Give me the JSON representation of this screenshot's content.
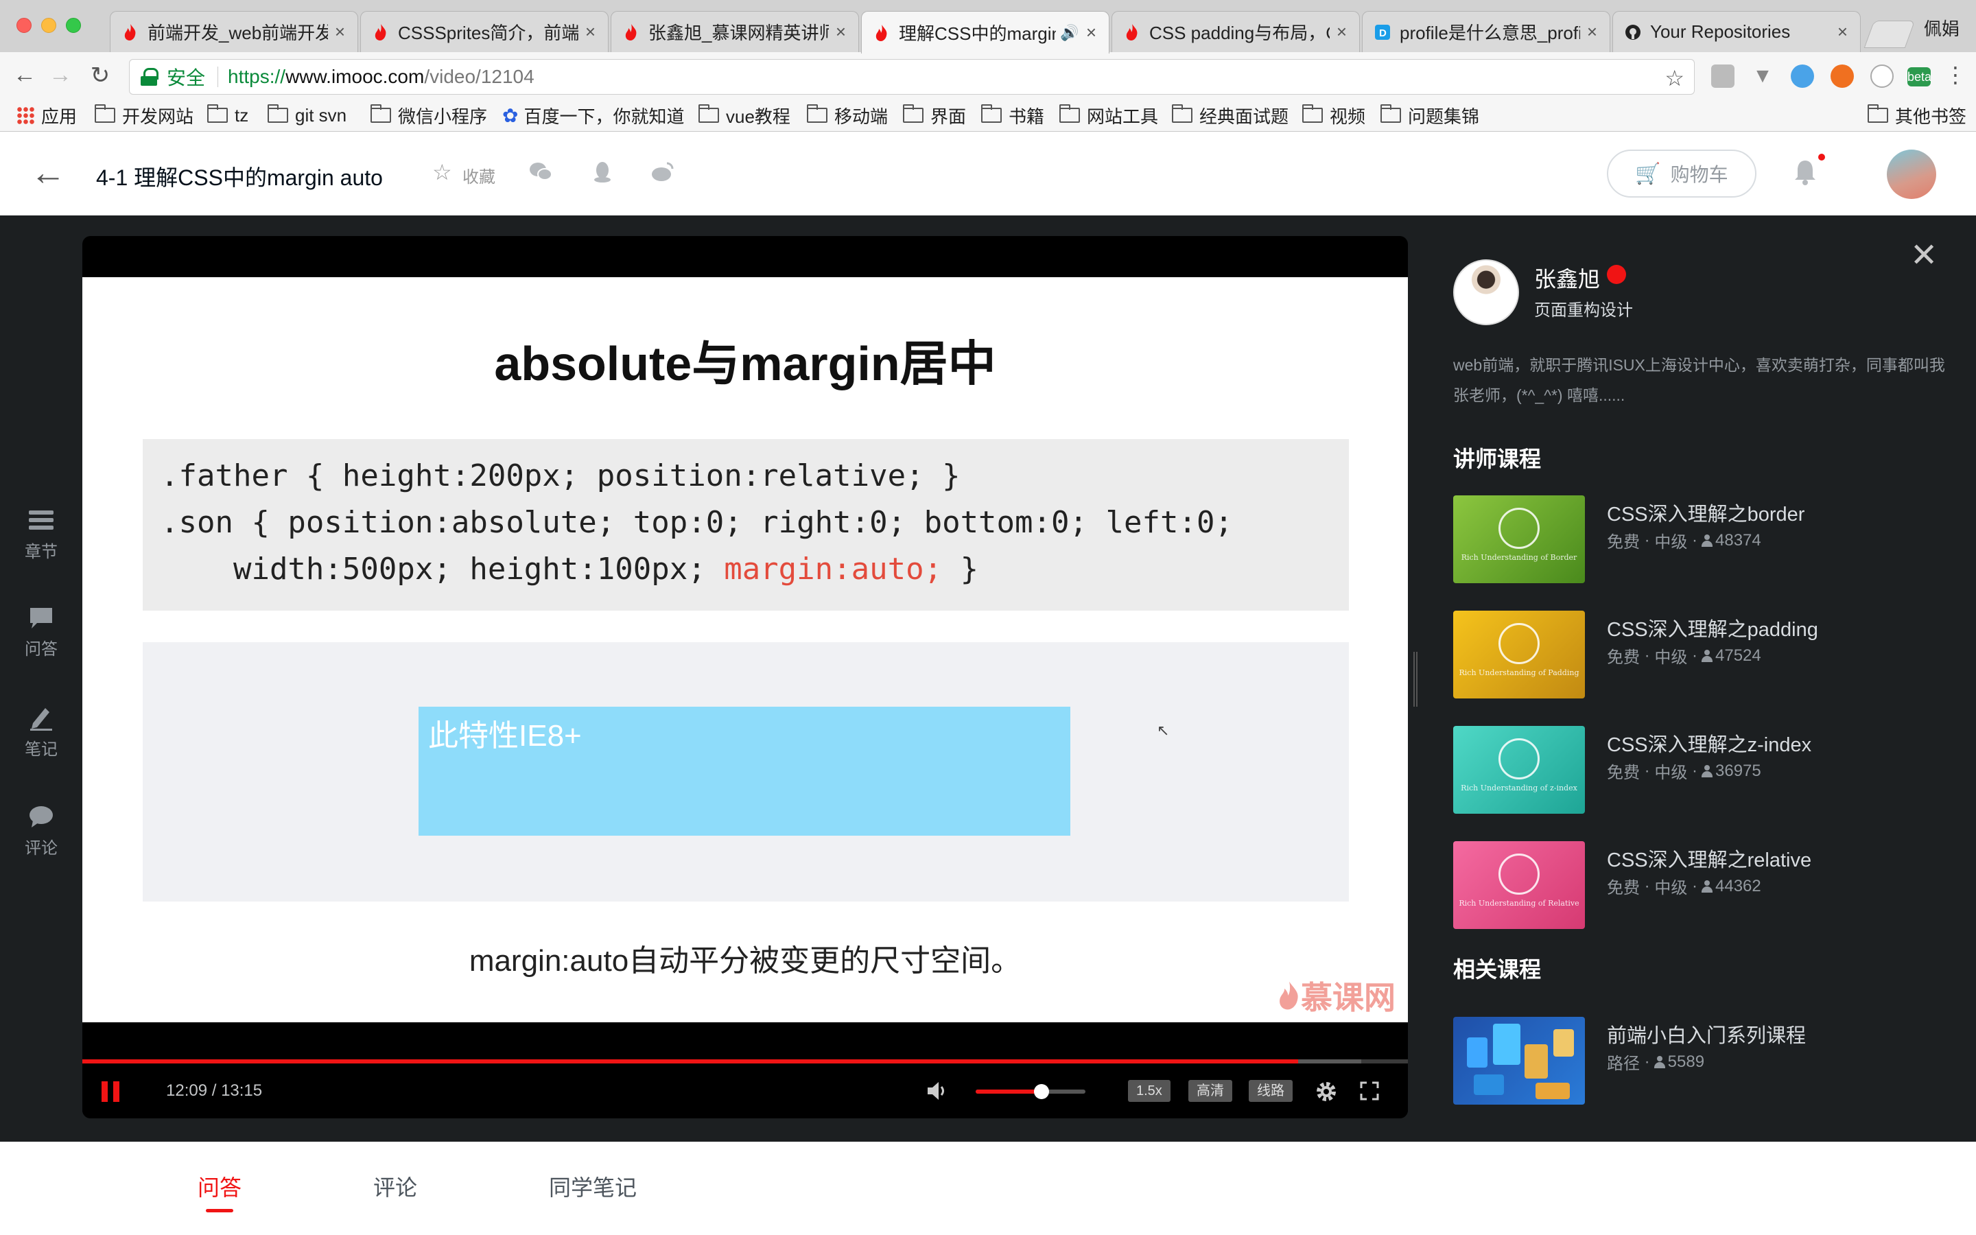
{
  "browser": {
    "tabs": [
      {
        "title": "前端开发_web前端开发",
        "favicon": "flame-icon",
        "active": false
      },
      {
        "title": "CSSSprites简介，前端",
        "favicon": "flame-icon",
        "active": false
      },
      {
        "title": "张鑫旭_慕课网精英讲师",
        "favicon": "flame-icon",
        "active": false
      },
      {
        "title": "理解CSS中的margin",
        "favicon": "flame-icon",
        "active": true
      },
      {
        "title": "CSS padding与布局，C",
        "favicon": "flame-icon",
        "active": false
      },
      {
        "title": "profile是什么意思_profi",
        "favicon": "d-icon",
        "active": false
      },
      {
        "title": "Your Repositories",
        "favicon": "github-icon",
        "active": false
      }
    ],
    "profile_name": "佩娟",
    "address": {
      "secure_label": "安全",
      "scheme": "https://",
      "host": "www.imooc.com",
      "path": "/video/12104"
    },
    "bookmarks": [
      "应用",
      "开发网站",
      "tz",
      "git svn",
      "微信小程序",
      "百度一下，你就知道",
      "vue教程",
      "移动端",
      "界面",
      "书籍",
      "网站工具",
      "经典面试题",
      "视频",
      "问题集锦"
    ],
    "other_bookmarks": "其他书签",
    "ext_beta_label": "beta"
  },
  "header": {
    "course_title": "4-1 理解CSS中的margin auto",
    "favorite_label": "收藏",
    "cart_label": "购物车"
  },
  "left_rail": [
    {
      "label": "章节",
      "icon": "chapters-icon"
    },
    {
      "label": "问答",
      "icon": "qa-icon"
    },
    {
      "label": "笔记",
      "icon": "note-pen-icon"
    },
    {
      "label": "评论",
      "icon": "comment-icon"
    }
  ],
  "slide": {
    "title": "absolute与margin居中",
    "code_lines": [
      {
        "text": ".father { height:200px; position:relative; }",
        "highlight": ""
      },
      {
        "text": ".son { position:absolute; top:0; right:0; bottom:0; left:0;",
        "highlight": ""
      },
      {
        "text": "    width:500px; height:100px; ",
        "highlight": "margin:auto;",
        "tail": " }"
      }
    ],
    "demo_text": "此特性IE8+",
    "caption": "margin:auto自动平分被变更的尺寸空间。",
    "watermark": "慕课网"
  },
  "player": {
    "time_current": "12:09",
    "time_total": "13:15",
    "time_display": "12:09 / 13:15",
    "progress_fraction": 0.917,
    "buffer_fraction": 0.965,
    "volume_fraction": 0.6,
    "speed_label": "1.5x",
    "quality_label": "高清",
    "line_label": "线路"
  },
  "teacher": {
    "name": "张鑫旭",
    "role": "页面重构设计",
    "bio": "web前端，就职于腾讯ISUX上海设计中心，喜欢卖萌打杂，同事都叫我张老师，(*^_^*) 嘻嘻......"
  },
  "teacher_courses_title": "讲师课程",
  "teacher_courses": [
    {
      "name": "CSS深入理解之border",
      "price": "免费",
      "level": "中级",
      "learners": "48374",
      "thumb_text": "Rich Understanding of Border",
      "color_a": "#8cc63f",
      "color_b": "#4a8a1c"
    },
    {
      "name": "CSS深入理解之padding",
      "price": "免费",
      "level": "中级",
      "learners": "47524",
      "thumb_text": "Rich Understanding of Padding",
      "color_a": "#f5c31c",
      "color_b": "#c28a12"
    },
    {
      "name": "CSS深入理解之z-index",
      "price": "免费",
      "level": "中级",
      "learners": "36975",
      "thumb_text": "Rich Understanding of z-index",
      "color_a": "#4fd8c6",
      "color_b": "#1ea596"
    },
    {
      "name": "CSS深入理解之relative",
      "price": "免费",
      "level": "中级",
      "learners": "44362",
      "thumb_text": "Rich Understanding of Relative",
      "color_a": "#f46aa0",
      "color_b": "#d63a72"
    }
  ],
  "related_title": "相关课程",
  "related_courses": [
    {
      "name": "前端小白入门系列课程",
      "type": "路径",
      "learners": "5589"
    }
  ],
  "bottom_tabs": [
    {
      "label": "问答",
      "active": true
    },
    {
      "label": "评论",
      "active": false
    },
    {
      "label": "同学笔记",
      "active": false
    }
  ],
  "colors": {
    "accent": "#f01414",
    "dark_bg": "#1c1f21",
    "secure_green": "#0a8a3a",
    "demo_blue": "#8edcfa"
  }
}
